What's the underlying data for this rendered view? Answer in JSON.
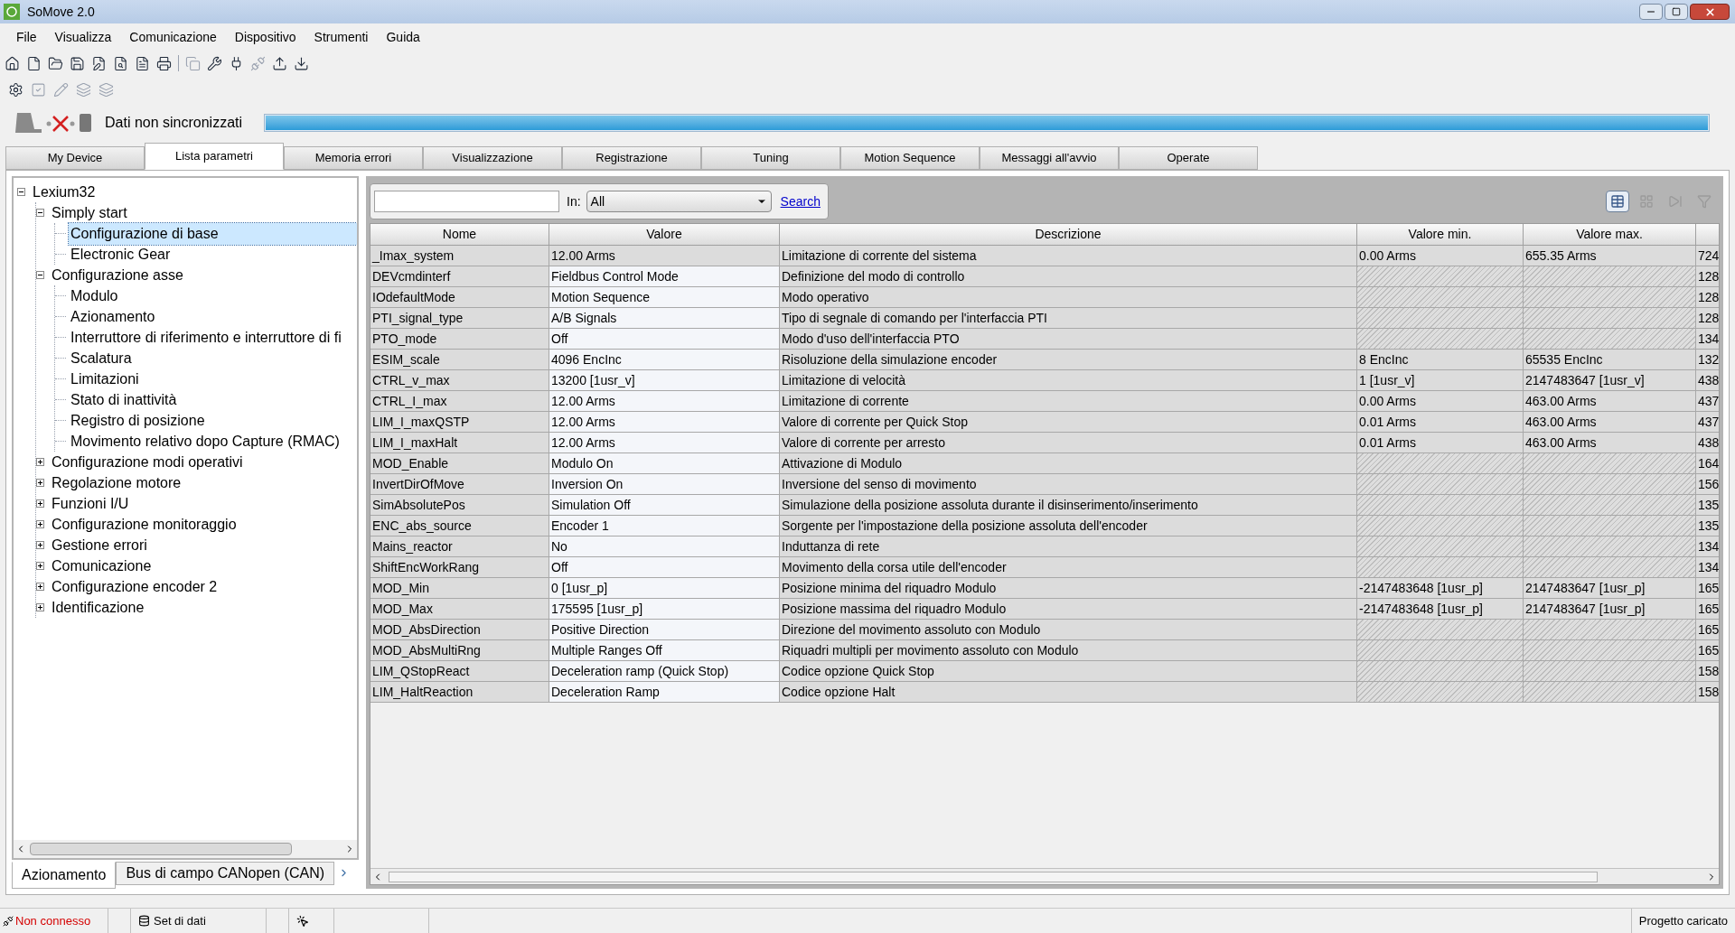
{
  "window": {
    "title": "SoMove 2.0"
  },
  "menu": [
    "File",
    "Visualizza",
    "Comunicazione",
    "Dispositivo",
    "Strumenti",
    "Guida"
  ],
  "sync": {
    "label": "Dati non sincronizzati",
    "level": 1
  },
  "tabs": [
    {
      "label": "My Device",
      "selected": false
    },
    {
      "label": "Lista parametri",
      "selected": true
    },
    {
      "label": "Memoria errori",
      "selected": false
    },
    {
      "label": "Visualizzazione",
      "selected": false
    },
    {
      "label": "Registrazione",
      "selected": false
    },
    {
      "label": "Tuning",
      "selected": false
    },
    {
      "label": "Motion Sequence",
      "selected": false
    },
    {
      "label": "Messaggi all'avvio",
      "selected": false
    },
    {
      "label": "Operate",
      "selected": false
    }
  ],
  "tree": [
    {
      "label": "Lexium32",
      "expanded": true,
      "selected": false,
      "children": [
        {
          "label": "Simply start",
          "expanded": true,
          "selected": false,
          "children": [
            {
              "label": "Configurazione di base",
              "selected": true
            },
            {
              "label": "Electronic Gear",
              "selected": false
            }
          ]
        },
        {
          "label": "Configurazione asse",
          "expanded": true,
          "selected": false,
          "children": [
            {
              "label": "Modulo",
              "selected": false
            },
            {
              "label": "Azionamento",
              "selected": false
            },
            {
              "label": "Interruttore di riferimento e interruttore di fi",
              "selected": false
            },
            {
              "label": "Scalatura",
              "selected": false
            },
            {
              "label": "Limitazioni",
              "selected": false
            },
            {
              "label": "Stato di inattività",
              "selected": false
            },
            {
              "label": "Registro di posizione",
              "selected": false
            },
            {
              "label": "Movimento relativo dopo Capture (RMAC)",
              "selected": false
            }
          ]
        },
        {
          "label": "Configurazione modi operativi",
          "expanded": false,
          "selected": false
        },
        {
          "label": "Regolazione motore",
          "expanded": false,
          "selected": false
        },
        {
          "label": "Funzioni I/U",
          "expanded": false,
          "selected": false
        },
        {
          "label": "Configurazione monitoraggio",
          "expanded": false,
          "selected": false
        },
        {
          "label": "Gestione errori",
          "expanded": false,
          "selected": false
        },
        {
          "label": "Comunicazione",
          "expanded": false,
          "selected": false
        },
        {
          "label": "Configurazione encoder 2",
          "expanded": false,
          "selected": false
        },
        {
          "label": "Identificazione",
          "expanded": false,
          "selected": false
        }
      ]
    }
  ],
  "bottom_tabs": [
    {
      "label": "Azionamento",
      "selected": true
    },
    {
      "label": "Bus di campo CANopen (CAN)",
      "selected": false
    }
  ],
  "filter": {
    "in_label": "In:",
    "scope": "All",
    "search_link": "Search"
  },
  "table": {
    "columns": [
      "Nome",
      "Valore",
      "Descrizione",
      "Valore min.",
      "Valore max."
    ],
    "rows": [
      {
        "name": "_Imax_system",
        "value": "12.00 Arms",
        "editable": false,
        "description": "Limitazione di corrente del sistema",
        "min": "0.00 Arms",
        "max": "655.35 Arms",
        "column_6": "724"
      },
      {
        "name": "DEVcmdinterf",
        "value": "Fieldbus Control Mode",
        "editable": true,
        "description": "Definizione del modo di controllo",
        "column_6": "128"
      },
      {
        "name": "IOdefaultMode",
        "value": "Motion Sequence",
        "editable": true,
        "description": "Modo operativo",
        "column_6": "128"
      },
      {
        "name": "PTI_signal_type",
        "value": "A/B Signals",
        "editable": true,
        "description": "Tipo di segnale di comando per l'interfaccia PTI",
        "column_6": "128"
      },
      {
        "name": "PTO_mode",
        "value": "Off",
        "editable": true,
        "description": "Modo d'uso dell'interfaccia PTO",
        "column_6": "134"
      },
      {
        "name": "ESIM_scale",
        "value": "4096 EncInc",
        "editable": true,
        "description": "Risoluzione della simulazione encoder",
        "min": "8 EncInc",
        "max": "65535 EncInc",
        "column_6": "132"
      },
      {
        "name": "CTRL_v_max",
        "value": "13200 [1usr_v]",
        "editable": true,
        "description": "Limitazione di velocità",
        "min": "1 [1usr_v]",
        "max": "2147483647 [1usr_v]",
        "column_6": "438"
      },
      {
        "name": "CTRL_I_max",
        "value": "12.00 Arms",
        "editable": true,
        "description": "Limitazione di corrente",
        "min": "0.00 Arms",
        "max": "463.00 Arms",
        "column_6": "437"
      },
      {
        "name": "LIM_I_maxQSTP",
        "value": "12.00 Arms",
        "editable": true,
        "description": "Valore di corrente per Quick Stop",
        "min": "0.01 Arms",
        "max": "463.00 Arms",
        "column_6": "437"
      },
      {
        "name": "LIM_I_maxHalt",
        "value": "12.00 Arms",
        "editable": true,
        "description": "Valore di corrente per arresto",
        "min": "0.01 Arms",
        "max": "463.00 Arms",
        "column_6": "438"
      },
      {
        "name": "MOD_Enable",
        "value": "Modulo On",
        "editable": true,
        "description": "Attivazione di Modulo",
        "column_6": "164"
      },
      {
        "name": "InvertDirOfMove",
        "value": "Inversion On",
        "editable": true,
        "description": "Inversione del senso di movimento",
        "column_6": "156"
      },
      {
        "name": "SimAbsolutePos",
        "value": "Simulation Off",
        "editable": true,
        "description": "Simulazione della posizione assoluta durante il disinserimento/inserimento",
        "column_6": "135"
      },
      {
        "name": "ENC_abs_source",
        "value": "Encoder 1",
        "editable": true,
        "description": "Sorgente per l'impostazione della posizione assoluta dell'encoder",
        "column_6": "135"
      },
      {
        "name": "Mains_reactor",
        "value": "No",
        "editable": true,
        "description": "Induttanza di rete",
        "column_6": "134"
      },
      {
        "name": "ShiftEncWorkRang",
        "value": "Off",
        "editable": true,
        "description": "Movimento della corsa utile dell'encoder",
        "column_6": "134"
      },
      {
        "name": "MOD_Min",
        "value": "0 [1usr_p]",
        "editable": true,
        "description": "Posizione minima del riquadro Modulo",
        "min": "-2147483648 [1usr_p]",
        "max": "2147483647 [1usr_p]",
        "column_6": "165"
      },
      {
        "name": "MOD_Max",
        "value": "175595 [1usr_p]",
        "editable": true,
        "description": "Posizione massima del riquadro Modulo",
        "min": "-2147483648 [1usr_p]",
        "max": "2147483647 [1usr_p]",
        "column_6": "165"
      },
      {
        "name": "MOD_AbsDirection",
        "value": "Positive Direction",
        "editable": true,
        "description": "Direzione del movimento assoluto con Modulo",
        "column_6": "165"
      },
      {
        "name": "MOD_AbsMultiRng",
        "value": "Multiple Ranges Off",
        "editable": true,
        "description": "Riquadri multipli per movimento assoluto con Modulo",
        "column_6": "165"
      },
      {
        "name": "LIM_QStopReact",
        "value": "Deceleration ramp (Quick Stop)",
        "editable": true,
        "description": "Codice opzione Quick Stop",
        "column_6": "158"
      },
      {
        "name": "LIM_HaltReaction",
        "value": "Deceleration Ramp",
        "editable": true,
        "description": "Codice opzione Halt",
        "column_6": "158"
      }
    ]
  },
  "status_bar": {
    "connection": "Non connesso",
    "dataset": "Set di dati",
    "project": "Progetto caricato"
  }
}
